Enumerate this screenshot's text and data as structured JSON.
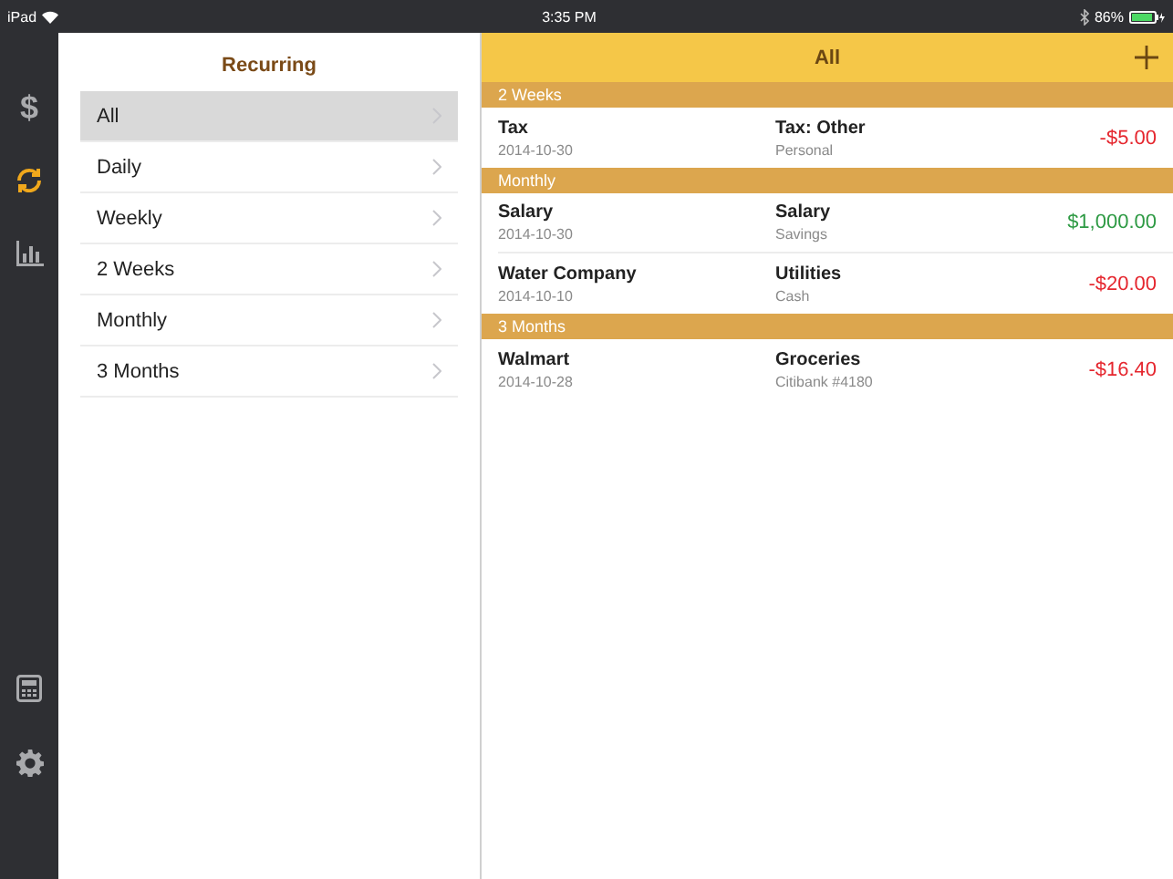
{
  "status_bar": {
    "device": "iPad",
    "time": "3:35 PM",
    "battery": "86%"
  },
  "rail": [
    {
      "kind": "dollar",
      "label": "$",
      "selected": false
    },
    {
      "kind": "sync",
      "selected": true
    },
    {
      "kind": "chart",
      "selected": false
    },
    {
      "kind": "calculator",
      "selected": false
    },
    {
      "kind": "settings",
      "selected": false
    }
  ],
  "sidebar": {
    "title": "Recurring",
    "items": [
      {
        "label": "All",
        "selected": true
      },
      {
        "label": "Daily",
        "selected": false
      },
      {
        "label": "Weekly",
        "selected": false
      },
      {
        "label": "2 Weeks",
        "selected": false
      },
      {
        "label": "Monthly",
        "selected": false
      },
      {
        "label": "3 Months",
        "selected": false
      }
    ]
  },
  "detail": {
    "title": "All",
    "sections": [
      {
        "title": "2 Weeks",
        "rows": [
          {
            "payee": "Tax",
            "date": "2014-10-30",
            "category": "Tax: Other",
            "account": "Personal",
            "amount": "-$5.00",
            "color": "#e5262e"
          }
        ]
      },
      {
        "title": "Monthly",
        "rows": [
          {
            "payee": "Salary",
            "date": "2014-10-30",
            "category": "Salary",
            "account": "Savings",
            "amount": "$1,000.00",
            "color": "#2e9a44"
          },
          {
            "payee": "Water Company",
            "date": "2014-10-10",
            "category": "Utilities",
            "account": "Cash",
            "amount": "-$20.00",
            "color": "#e5262e"
          }
        ]
      },
      {
        "title": "3 Months",
        "rows": [
          {
            "payee": "Walmart",
            "date": "2014-10-28",
            "category": "Groceries",
            "account": "Citibank #4180",
            "amount": "-$16.40",
            "color": "#e5262e"
          }
        ]
      }
    ]
  }
}
